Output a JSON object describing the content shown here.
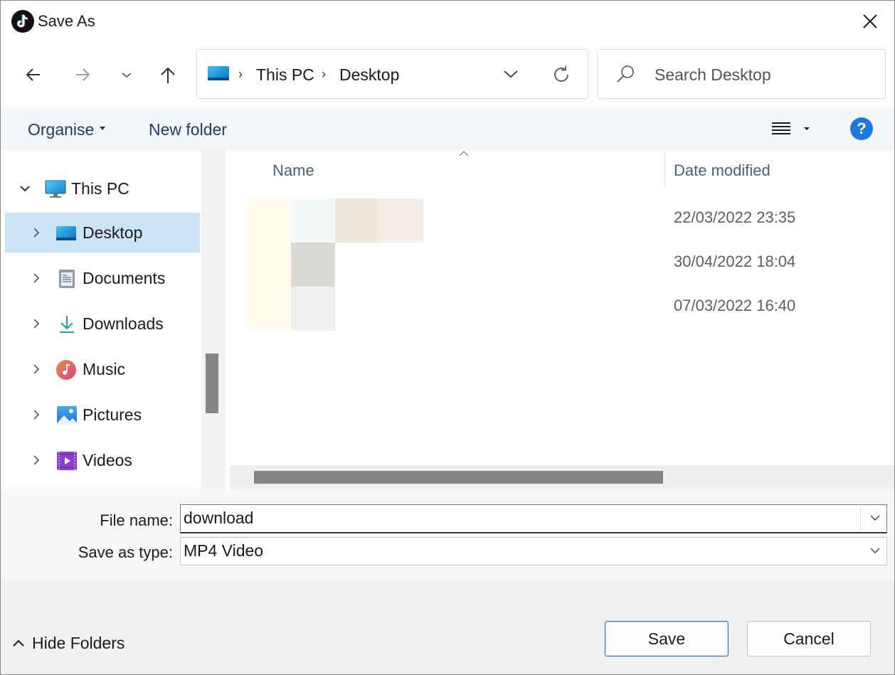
{
  "window": {
    "title": "Save As",
    "app_icon": "tiktok-icon",
    "close_icon": "close-icon"
  },
  "nav": {
    "back_icon": "arrow-left-icon",
    "forward_icon": "arrow-right-icon",
    "recent_icon": "chevron-down-icon",
    "up_icon": "arrow-up-icon",
    "breadcrumbs": [
      "This PC",
      "Desktop"
    ],
    "refresh_icon": "refresh-icon"
  },
  "search": {
    "placeholder": "Search Desktop",
    "icon": "search-icon"
  },
  "commands": {
    "organise": "Organise",
    "new_folder": "New folder",
    "view_icon": "details-view-icon",
    "help": "?"
  },
  "tree": {
    "root": "This PC",
    "items": [
      {
        "label": "Desktop",
        "icon": "desktop-icon",
        "selected": true
      },
      {
        "label": "Documents",
        "icon": "documents-icon"
      },
      {
        "label": "Downloads",
        "icon": "downloads-icon"
      },
      {
        "label": "Music",
        "icon": "music-icon"
      },
      {
        "label": "Pictures",
        "icon": "pictures-icon"
      },
      {
        "label": "Videos",
        "icon": "videos-icon"
      }
    ]
  },
  "columns": {
    "name": "Name",
    "date_modified": "Date modified"
  },
  "files": [
    {
      "date": "22/03/2022 23:35"
    },
    {
      "date": "30/04/2022 18:04"
    },
    {
      "date": "07/03/2022 16:40"
    }
  ],
  "fields": {
    "file_name_label": "File name:",
    "file_name_value": "download",
    "save_type_label": "Save as type:",
    "save_type_value": "MP4 Video"
  },
  "footer": {
    "hide_folders": "Hide Folders",
    "save": "Save",
    "cancel": "Cancel"
  },
  "colors": {
    "selected_bg": "#cce4f7",
    "help_blue": "#1a7ad9",
    "primary_border": "#2a6fb8"
  }
}
